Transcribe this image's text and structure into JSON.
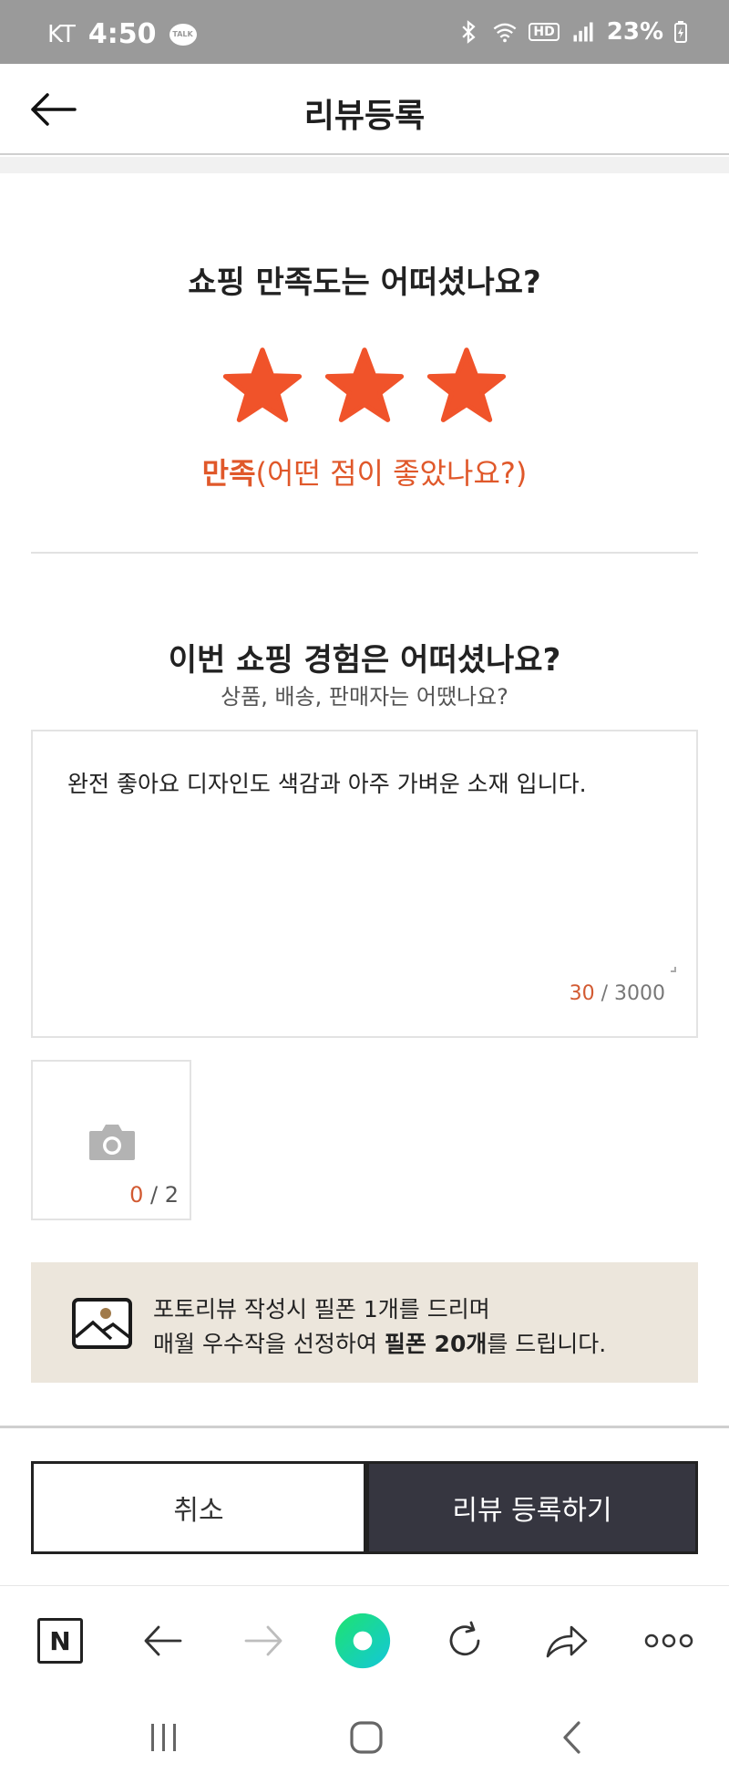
{
  "status_bar": {
    "carrier": "KT",
    "time": "4:50",
    "talk_badge": "TALK",
    "hd_badge": "HD",
    "battery": "23%"
  },
  "header": {
    "title": "리뷰등록",
    "back_icon": "arrow-left-icon"
  },
  "rating": {
    "question": "쇼핑 만족도는 어떠셨나요?",
    "value": 3,
    "max": 5,
    "star_color": "#f0532a",
    "label_strong": "만족",
    "label_rest": "(어떤 점이 좋았나요?)"
  },
  "experience": {
    "question": "이번 쇼핑 경험은 어떠셨나요?",
    "subquestion": "상품, 배송, 판매자는 어땠나요?",
    "review_text": "완전 좋아요 디자인도 색감과 아주 가벼운 소재 입니다.",
    "char_count": "30",
    "char_limit": " / 3000"
  },
  "photo": {
    "count": "0",
    "limit": " / 2",
    "icon": "camera-icon"
  },
  "notice": {
    "line1": "포토리뷰 작성시 필폰 1개를 드리며",
    "line2_pre": "매월 우수작을 선정하여 ",
    "line2_bold": "필폰 20개",
    "line2_post": "를 드립니다.",
    "icon": "image-icon"
  },
  "actions": {
    "cancel_label": "취소",
    "submit_label": "리뷰 등록하기"
  },
  "browser_bar": {
    "naver_label": "N",
    "icons": [
      "naver-home-icon",
      "back-icon",
      "forward-icon",
      "green-dot-icon",
      "refresh-icon",
      "share-icon",
      "more-icon"
    ]
  },
  "colors": {
    "accent_orange": "#e0582a",
    "dark_button": "#363640",
    "notice_bg": "#ece6dc",
    "green": "#1fd8a0"
  }
}
